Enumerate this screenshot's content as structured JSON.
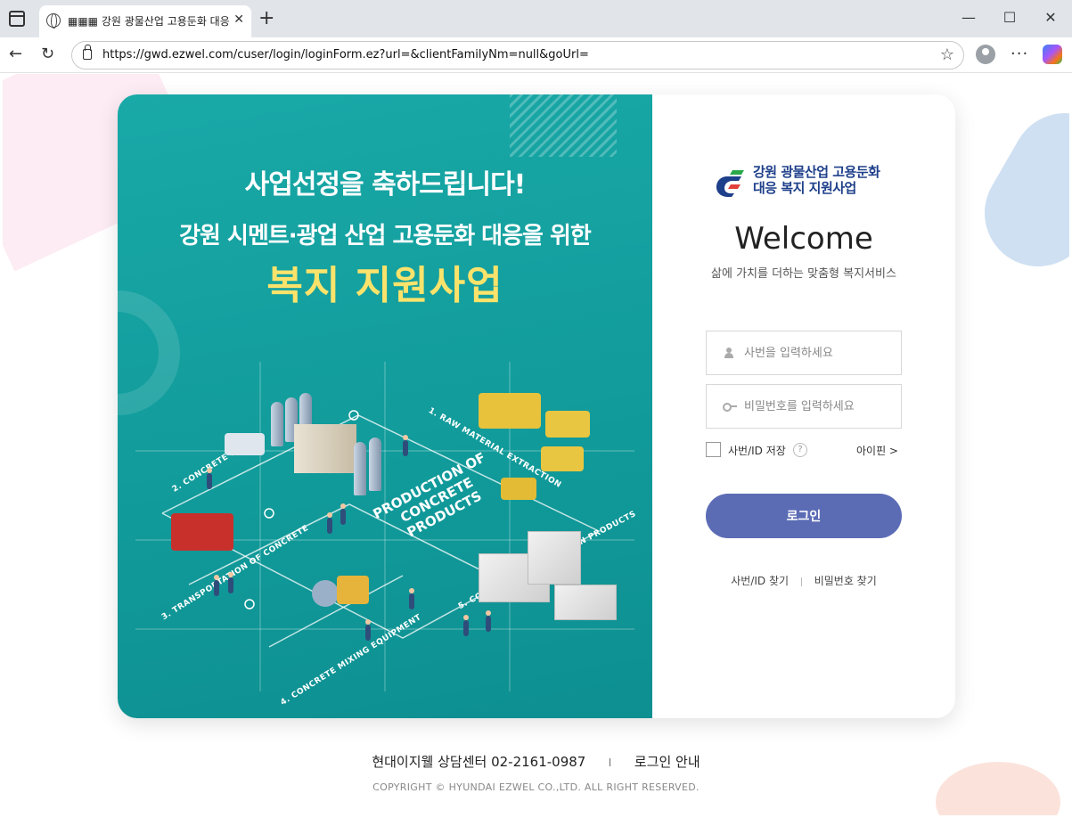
{
  "browser": {
    "tab_title": "▦▦▦ 강원 광물산업 고용둔화 대응",
    "tab_close": "✕",
    "new_tab": "+",
    "url": "https://gwd.ezwel.com/cuser/login/loginForm.ez?url=&clientFamilyNm=null&goUrl=",
    "minimize": "—",
    "maximize": "☐",
    "close": "✕",
    "back": "←",
    "reload": "↻",
    "star": "☆",
    "more": "···"
  },
  "banner": {
    "headline": "사업선정을 축하드립니다!",
    "subheadline": "강원 시멘트·광업 산업 고용둔화 대응을 위한",
    "highlight": "복지 지원사업",
    "illustration": {
      "center_label_lines": [
        "PRODUCTION OF",
        "CONCRETE",
        "PRODUCTS"
      ],
      "steps": [
        "1. RAW MATERIAL EXTRACTION",
        "2. CONCRETE PLANT",
        "3. TRANSPORTATION OF CONCRETE",
        "4. CONCRETE MIXING EQUIPMENT",
        "5. CONCRETE CONSTRUCTION PRODUCTS"
      ]
    }
  },
  "login": {
    "logo_line1": "강원 광물산업 고용둔화",
    "logo_line2": "대응 복지 지원사업",
    "welcome": "Welcome",
    "subtitle": "삶에 가치를 더하는 맞춤형 복지서비스",
    "id_placeholder": "사번을 입력하세요",
    "pw_placeholder": "비밀번호를 입력하세요",
    "save_id_label": "사번/ID 저장",
    "help": "?",
    "ipin_label": "아이핀 >",
    "login_button": "로그인",
    "find_id": "사번/ID 찾기",
    "find_pw": "비밀번호 찾기"
  },
  "footer": {
    "call_center": "현대이지웰 상담센터 02-2161-0987",
    "login_guide": "로그인 안내",
    "copyright": "COPYRIGHT © HYUNDAI EZWEL CO.,LTD. ALL RIGHT RESERVED."
  },
  "colors": {
    "banner_teal": "#17a3a3",
    "highlight_yellow": "#fbe36b",
    "login_button": "#5b6cb5",
    "logo_blue": "#1e3f8a",
    "logo_green": "#2aa84a",
    "logo_red": "#e2403a"
  }
}
